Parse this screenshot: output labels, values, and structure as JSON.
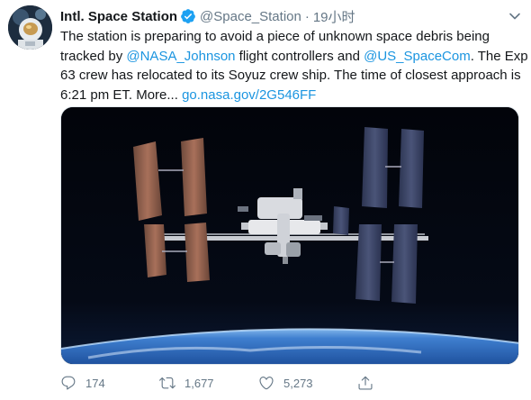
{
  "tweet": {
    "display_name": "Intl. Space Station",
    "handle": "@Space_Station",
    "separator": "·",
    "timestamp": "19小时",
    "text": {
      "line1": "The station is preparing to avoid a piece of unknown space debris being",
      "line2_a": "tracked by ",
      "mention1": "@NASA_Johnson",
      "line2_b": " flight controllers and ",
      "mention2": "@US_SpaceCom",
      "line2_c": ". The Exp",
      "line3": "63 crew has relocated to its Soyuz crew ship. The time of closest approach is",
      "line4_a": "6:21 pm ET. More... ",
      "link": "go.nasa.gov/2G546FF"
    },
    "actions": {
      "reply_count": "174",
      "retweet_count": "1,677",
      "like_count": "5,273"
    }
  },
  "icons": {
    "verified": "verified-badge-icon",
    "caret": "chevron-down-icon",
    "reply": "reply-icon",
    "retweet": "retweet-icon",
    "like": "heart-icon",
    "share": "share-icon"
  },
  "colors": {
    "link": "#1b95e0",
    "muted": "#657786",
    "text": "#14171a",
    "verified": "#1da1f2"
  }
}
